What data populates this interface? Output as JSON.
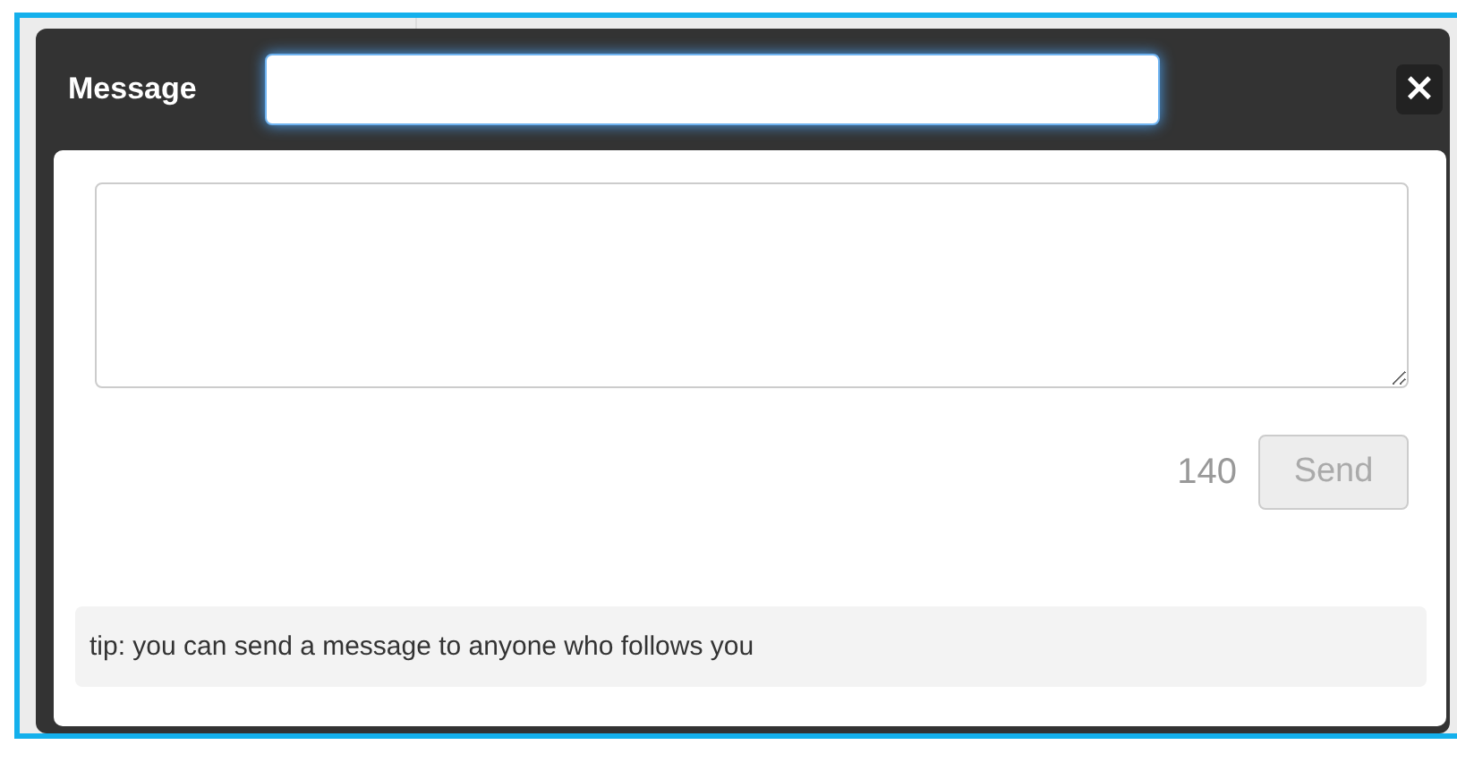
{
  "dialog": {
    "title": "Message",
    "close": "×",
    "char_count": "140",
    "send_button": {
      "label": "Send",
      "disabled": true
    },
    "tip": "tip: you can send a message to anyone who follows you"
  }
}
